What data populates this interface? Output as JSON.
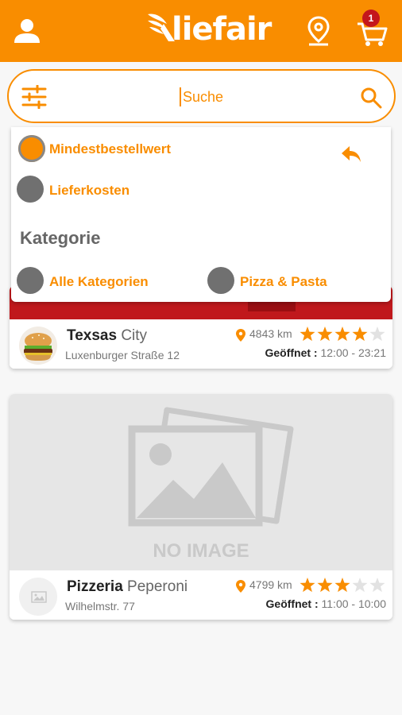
{
  "header": {
    "logo_text": "liefair",
    "cart_count": "1"
  },
  "search": {
    "placeholder": "Suche",
    "value": ""
  },
  "filters": {
    "min_order_label": "Mindestbestellwert",
    "delivery_cost_label": "Lieferkosten",
    "category_heading": "Kategorie",
    "categories": [
      "Alle Kategorien",
      "Pizza & Pasta"
    ]
  },
  "restaurants": [
    {
      "name_bold": "Texsas",
      "name_light": "City",
      "address": "Luxenburger Straße 12",
      "distance": "4843 km",
      "rating": 4,
      "open_label": "Geöffnet :",
      "hours": "12:00 - 23:21"
    },
    {
      "name_bold": "Pizzeria",
      "name_light": "Peperoni",
      "address": "Wilhelmstr. 77",
      "distance": "4799 km",
      "rating": 3,
      "open_label": "Geöffnet :",
      "hours": "11:00 - 10:00",
      "placeholder_text": "NO IMAGE"
    }
  ],
  "colors": {
    "brand": "#f98d00",
    "radio_off": "#707070",
    "star_on": "#f98d00",
    "star_off": "#e2e2e2"
  }
}
